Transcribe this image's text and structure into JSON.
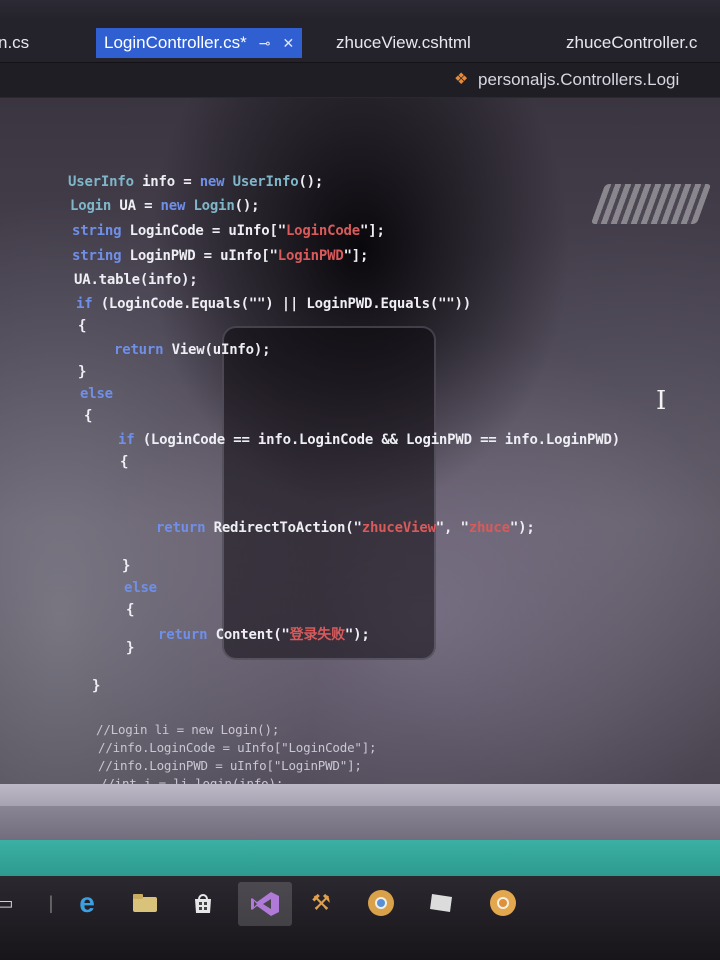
{
  "tabs": [
    {
      "label": "n.cs",
      "active": false
    },
    {
      "label": "LoginController.cs*",
      "active": true
    },
    {
      "label": "zhuceView.cshtml",
      "active": false
    },
    {
      "label": "zhuceController.c",
      "active": false
    }
  ],
  "nav": {
    "path": "personaljs.Controllers.Logi",
    "icon": "class-icon"
  },
  "code_lines": [
    "UserInfo info = new UserInfo();",
    "Login UA = new Login();",
    "string LoginCode = uInfo[\"LoginCode\"];",
    "string LoginPWD = uInfo[\"LoginPWD\"];",
    "UA.table(info);",
    "if (LoginCode.Equals(\"\") || LoginPWD.Equals(\"\"))",
    "{",
    "return View(uInfo);",
    "}",
    "else",
    "{",
    "if (LoginCode == info.LoginCode && LoginPWD == info.LoginPWD)",
    "{",
    "return RedirectToAction(\"zhuceView\", \"zhuce\");",
    "}",
    "else",
    "{",
    "return Content(\"登录失败\");",
    "}",
    "}",
    "//Login li = new Login();",
    "//info.LoginCode = uInfo[\"LoginCode\"];",
    "//info.LoginPWD = uInfo[\"LoginPWD\"];",
    "//int i = li.login(info);"
  ],
  "colors": {
    "tab_active": "#2f5fd0",
    "keyword": "#6f8fe8",
    "type": "#7fb6c9",
    "string": "#d85a5a",
    "accent_bar": "#3bb0a3"
  },
  "taskbar_icons": [
    "task-view-icon",
    "edge-icon",
    "file-explorer-icon",
    "store-icon",
    "visual-studio-icon",
    "tools-icon",
    "chrome-icon",
    "notes-icon",
    "chrome-icon"
  ]
}
